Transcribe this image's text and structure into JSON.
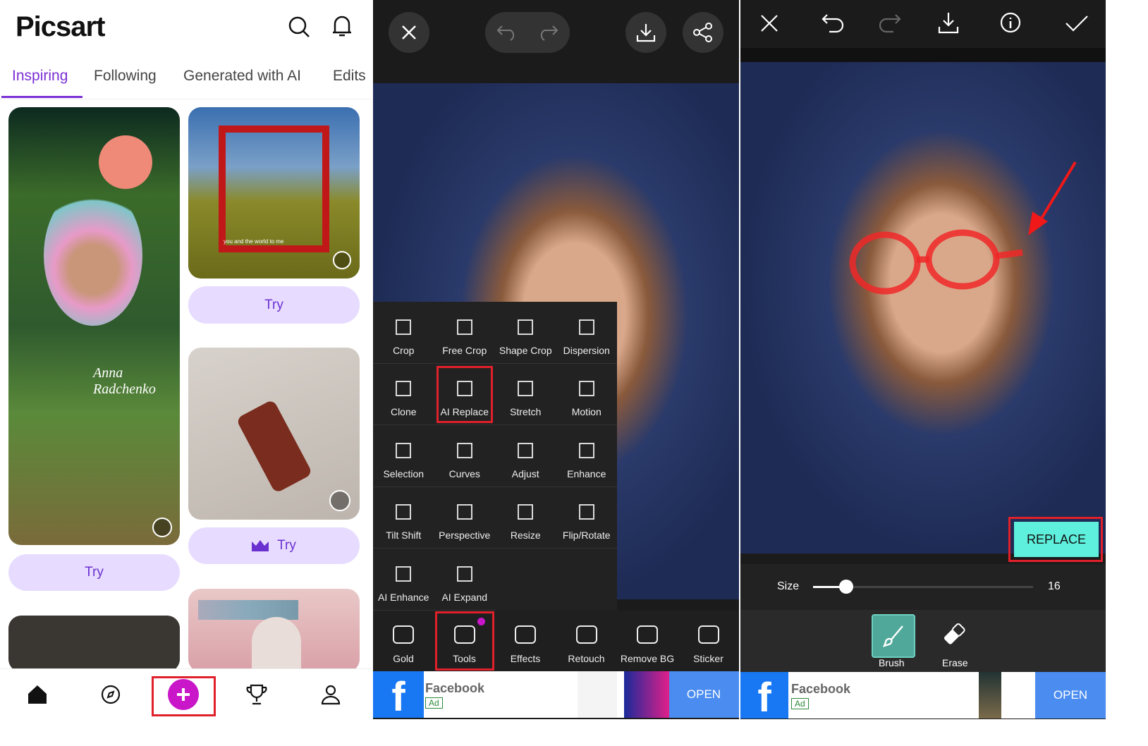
{
  "feed": {
    "logo": "Picsart",
    "tabs": [
      {
        "label": "Inspiring",
        "active": true
      },
      {
        "label": "Following"
      },
      {
        "label": "Generated with AI"
      },
      {
        "label": "Edits"
      }
    ],
    "try_label": "Try",
    "card_signature": "Anna Radchenko",
    "card_caption": "you and the world to me",
    "nav": [
      "home-icon",
      "compass-icon",
      "plus-icon",
      "trophy-icon",
      "profile-icon"
    ],
    "accent": "#7b2fd6"
  },
  "tools_screen": {
    "menu": [
      {
        "label": "Crop",
        "icon": "crop-icon"
      },
      {
        "label": "Free Crop",
        "icon": "free-crop-icon"
      },
      {
        "label": "Shape Crop",
        "icon": "shape-crop-icon"
      },
      {
        "label": "Dispersion",
        "icon": "dispersion-icon"
      },
      {
        "label": "Clone",
        "icon": "clone-icon"
      },
      {
        "label": "AI Replace",
        "icon": "ai-replace-icon",
        "highlighted": true
      },
      {
        "label": "Stretch",
        "icon": "stretch-icon"
      },
      {
        "label": "Motion",
        "icon": "motion-icon"
      },
      {
        "label": "Selection",
        "icon": "selection-icon"
      },
      {
        "label": "Curves",
        "icon": "curves-icon"
      },
      {
        "label": "Adjust",
        "icon": "adjust-icon"
      },
      {
        "label": "Enhance",
        "icon": "enhance-icon"
      },
      {
        "label": "Tilt Shift",
        "icon": "tilt-shift-icon"
      },
      {
        "label": "Perspective",
        "icon": "perspective-icon"
      },
      {
        "label": "Resize",
        "icon": "resize-icon"
      },
      {
        "label": "Flip/Rotate",
        "icon": "flip-rotate-icon"
      },
      {
        "label": "AI Enhance",
        "icon": "ai-enhance-icon"
      },
      {
        "label": "AI Expand",
        "icon": "ai-expand-icon"
      }
    ],
    "toolbar": [
      {
        "label": "Gold"
      },
      {
        "label": "Tools",
        "highlighted": true
      },
      {
        "label": "Effects"
      },
      {
        "label": "Retouch"
      },
      {
        "label": "Remove BG"
      },
      {
        "label": "Sticker"
      }
    ],
    "ad": {
      "name": "Facebook",
      "badge": "Ad",
      "cta": "OPEN"
    }
  },
  "replace_screen": {
    "replace_label": "REPLACE",
    "size_label": "Size",
    "size_value": "16",
    "size_fraction": 0.15,
    "brush_label": "Brush",
    "erase_label": "Erase",
    "ad": {
      "name": "Facebook",
      "badge": "Ad",
      "cta": "OPEN"
    },
    "replace_color": "#5ef0dc"
  }
}
